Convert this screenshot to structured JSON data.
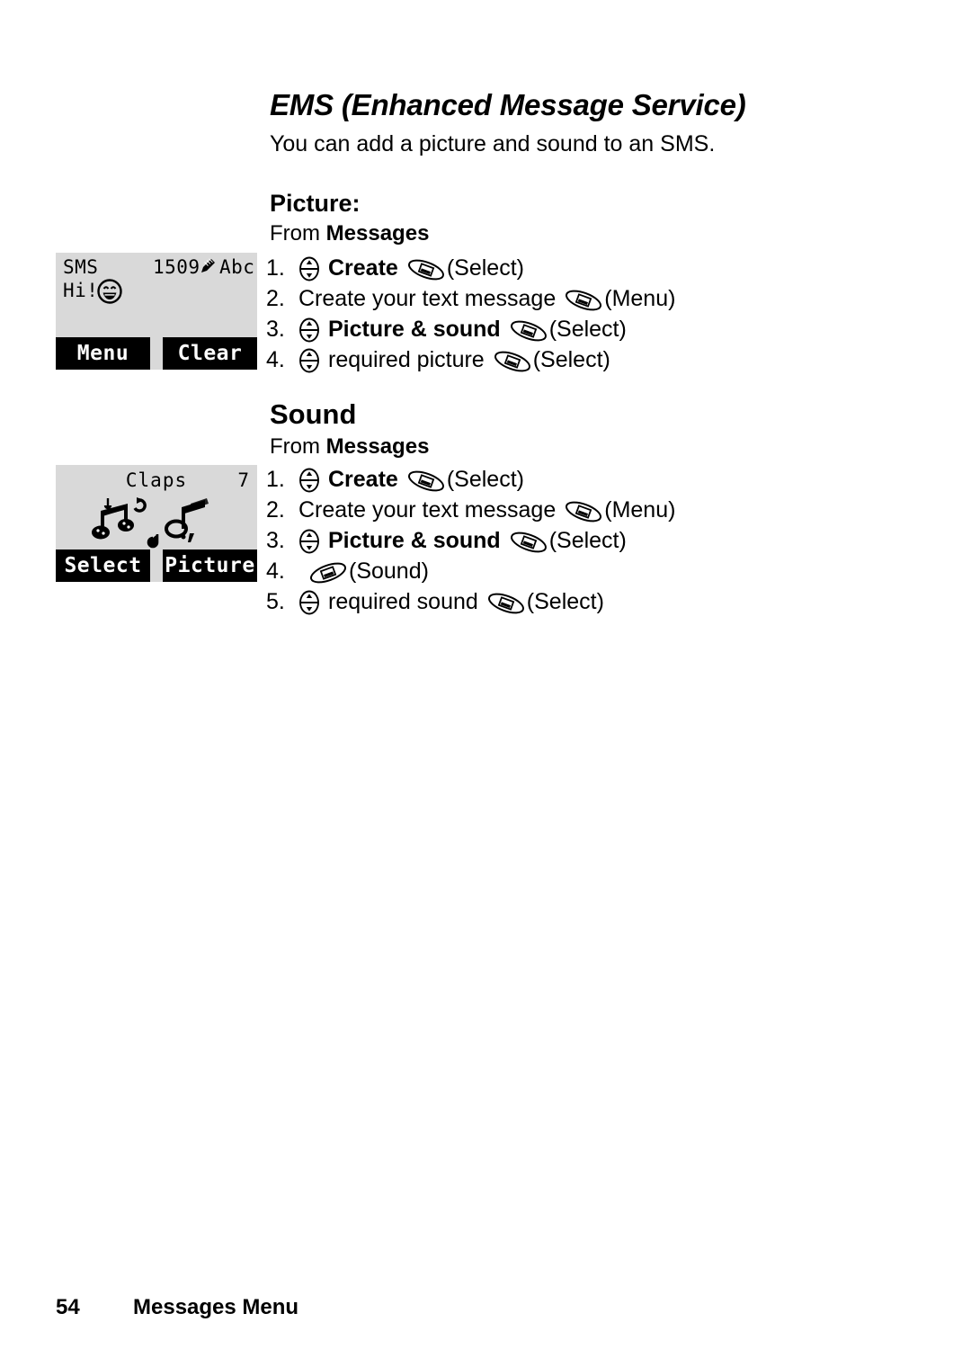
{
  "page": {
    "title": "EMS (Enhanced Message Service)",
    "intro": "You can add a picture and sound to an SMS."
  },
  "picture_section": {
    "heading": "Picture:",
    "from_prefix": "From ",
    "from_target": "Messages",
    "steps": [
      {
        "num": "1.",
        "nav_icon": "navigation-key-icon",
        "text": "Create",
        "bold": true,
        "soft_icon": "right-soft-key-icon",
        "soft_label": "(Select)"
      },
      {
        "num": "2.",
        "nav_icon": "",
        "text": "Create your text message",
        "bold": false,
        "soft_icon": "right-soft-key-icon",
        "soft_label": "(Menu)"
      },
      {
        "num": "3.",
        "nav_icon": "navigation-key-icon",
        "text": "Picture & sound",
        "bold": true,
        "soft_icon": "right-soft-key-icon",
        "soft_label": "(Select)"
      },
      {
        "num": "4.",
        "nav_icon": "navigation-key-icon",
        "text": "required picture",
        "bold": false,
        "soft_icon": "right-soft-key-icon",
        "soft_label": "(Select)"
      }
    ]
  },
  "sound_section": {
    "heading": "Sound",
    "from_prefix": "From ",
    "from_target": "Messages",
    "steps": [
      {
        "num": "1.",
        "nav_icon": "navigation-key-icon",
        "text": "Create",
        "bold": true,
        "soft_icon": "right-soft-key-icon",
        "soft_label": "(Select)"
      },
      {
        "num": "2.",
        "nav_icon": "",
        "text": "Create your text message",
        "bold": false,
        "soft_icon": "right-soft-key-icon",
        "soft_label": "(Menu)"
      },
      {
        "num": "3.",
        "nav_icon": "navigation-key-icon",
        "text": "Picture & sound",
        "bold": true,
        "soft_icon": "right-soft-key-icon",
        "soft_label": "(Select)"
      },
      {
        "num": "4.",
        "nav_icon": "",
        "text": "",
        "bold": false,
        "soft_icon": "left-soft-key-icon",
        "soft_label": "(Sound)"
      },
      {
        "num": "5.",
        "nav_icon": "navigation-key-icon",
        "text": "required sound",
        "bold": false,
        "soft_icon": "right-soft-key-icon",
        "soft_label": "(Select)"
      }
    ]
  },
  "sms_screen": {
    "label": "SMS",
    "counter": "1509",
    "pencil_icon": "pencil-icon",
    "input_mode": "Abc",
    "body_text": "Hi!",
    "emoticon_icon": "smiley-face-icon",
    "left_softkey": "Menu",
    "right_softkey": "Clear"
  },
  "sound_screen": {
    "title": "Claps",
    "index": "7",
    "notes_icon": "music-notes-icon",
    "left_softkey": "Select",
    "right_softkey": "Picture"
  },
  "footer": {
    "page_number": "54",
    "section": "Messages Menu"
  },
  "colors": {
    "page_background": "#ffffff",
    "text": "#000000",
    "lcd_background": "#d9d9d9",
    "softkey_background": "#000000",
    "softkey_text": "#ffffff"
  }
}
